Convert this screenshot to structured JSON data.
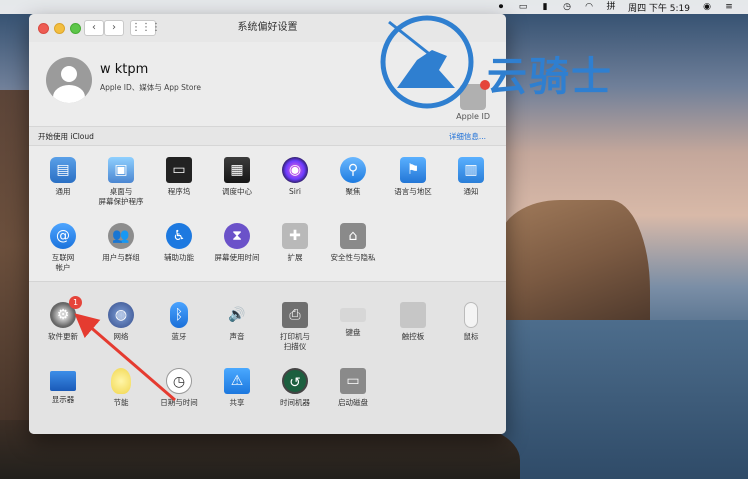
{
  "menubar": {
    "clock": "周四 下午 5:19"
  },
  "watermark": {
    "text": "云骑士"
  },
  "window": {
    "title": "系统偏好设置",
    "nav_back": "‹",
    "nav_forward": "›",
    "grid_button": "⋮⋮⋮"
  },
  "user": {
    "name": "w ktpm",
    "subtitle": "Apple ID、媒体与 App Store",
    "appleid_label": "Apple ID"
  },
  "icloud": {
    "text": "开始使用 iCloud",
    "link": "详细信息..."
  },
  "row1": [
    {
      "label": "通用",
      "glyph": "▤"
    },
    {
      "label": "桌面与\n屏幕保护程序",
      "glyph": "▣"
    },
    {
      "label": "程序坞",
      "glyph": "▭"
    },
    {
      "label": "调度中心",
      "glyph": "▦"
    },
    {
      "label": "Siri",
      "glyph": "◉"
    },
    {
      "label": "聚焦",
      "glyph": "⚲"
    },
    {
      "label": "语言与地区",
      "glyph": "⚑"
    },
    {
      "label": "通知",
      "glyph": "▥"
    }
  ],
  "row2": [
    {
      "label": "互联网\n帐户",
      "glyph": "@"
    },
    {
      "label": "用户与群组",
      "glyph": "👥"
    },
    {
      "label": "辅助功能",
      "glyph": "♿"
    },
    {
      "label": "屏幕使用时间",
      "glyph": "⧗"
    },
    {
      "label": "扩展",
      "glyph": "✚"
    },
    {
      "label": "安全性与隐私",
      "glyph": "⌂"
    }
  ],
  "row3": [
    {
      "label": "软件更新",
      "glyph": "⚙",
      "badge": "1"
    },
    {
      "label": "网络",
      "glyph": "◍"
    },
    {
      "label": "蓝牙",
      "glyph": "ᛒ"
    },
    {
      "label": "声音",
      "glyph": "🔊"
    },
    {
      "label": "打印机与\n扫描仪",
      "glyph": "⎙"
    },
    {
      "label": "键盘",
      "glyph": ""
    },
    {
      "label": "触控板",
      "glyph": ""
    },
    {
      "label": "鼠标",
      "glyph": ""
    }
  ],
  "row4": [
    {
      "label": "显示器",
      "glyph": ""
    },
    {
      "label": "节能",
      "glyph": ""
    },
    {
      "label": "日期与时间",
      "glyph": "◷"
    },
    {
      "label": "共享",
      "glyph": "⚠"
    },
    {
      "label": "时间机器",
      "glyph": "↺"
    },
    {
      "label": "启动磁盘",
      "glyph": "▭"
    }
  ],
  "colors": {
    "arrow": "#e53b30",
    "link": "#1a6ed8",
    "watermark": "#2f7fd0"
  }
}
